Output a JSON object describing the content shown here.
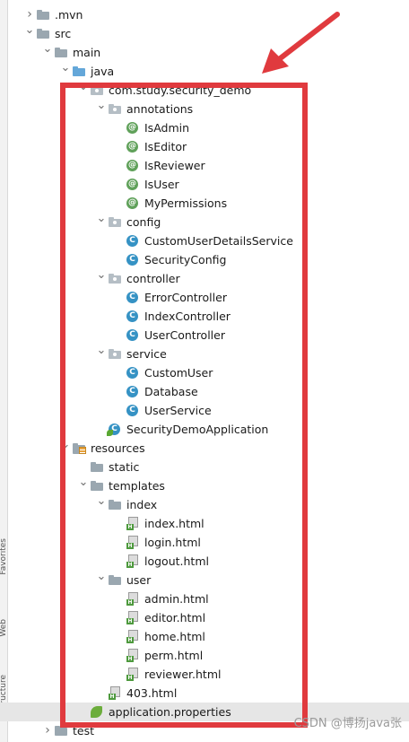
{
  "side_tabs": [
    "Favorites",
    "Web",
    "Structure"
  ],
  "tree": [
    {
      "label": ".mvn",
      "icon": "folder-icon",
      "arrow": "collapsed"
    },
    {
      "label": "src",
      "icon": "folder-icon",
      "arrow": "expanded"
    },
    {
      "label": "main",
      "icon": "folder-icon",
      "arrow": "expanded"
    },
    {
      "label": "java",
      "icon": "source-folder-icon",
      "arrow": "expanded"
    },
    {
      "label": "com.study.security_demo",
      "icon": "package-icon",
      "arrow": "expanded"
    },
    {
      "label": "annotations",
      "icon": "package-icon",
      "arrow": "expanded"
    },
    {
      "label": "IsAdmin",
      "icon": "annotation-icon",
      "arrow": "none"
    },
    {
      "label": "IsEditor",
      "icon": "annotation-icon",
      "arrow": "none"
    },
    {
      "label": "IsReviewer",
      "icon": "annotation-icon",
      "arrow": "none"
    },
    {
      "label": "IsUser",
      "icon": "annotation-icon",
      "arrow": "none"
    },
    {
      "label": "MyPermissions",
      "icon": "annotation-icon",
      "arrow": "none"
    },
    {
      "label": "config",
      "icon": "package-icon",
      "arrow": "expanded"
    },
    {
      "label": "CustomUserDetailsService",
      "icon": "class-icon",
      "arrow": "none"
    },
    {
      "label": "SecurityConfig",
      "icon": "class-icon",
      "arrow": "none"
    },
    {
      "label": "controller",
      "icon": "package-icon",
      "arrow": "expanded"
    },
    {
      "label": "ErrorController",
      "icon": "class-icon",
      "arrow": "none"
    },
    {
      "label": "IndexController",
      "icon": "class-icon",
      "arrow": "none"
    },
    {
      "label": "UserController",
      "icon": "class-icon",
      "arrow": "none"
    },
    {
      "label": "service",
      "icon": "package-icon",
      "arrow": "expanded"
    },
    {
      "label": "CustomUser",
      "icon": "class-icon",
      "arrow": "none"
    },
    {
      "label": "Database",
      "icon": "class-icon",
      "arrow": "none"
    },
    {
      "label": "UserService",
      "icon": "class-icon",
      "arrow": "none"
    },
    {
      "label": "SecurityDemoApplication",
      "icon": "spring-boot-class-icon",
      "arrow": "none"
    },
    {
      "label": "resources",
      "icon": "resources-folder-icon",
      "arrow": "expanded"
    },
    {
      "label": "static",
      "icon": "folder-icon",
      "arrow": "none"
    },
    {
      "label": "templates",
      "icon": "folder-icon",
      "arrow": "expanded"
    },
    {
      "label": "index",
      "icon": "folder-icon",
      "arrow": "expanded"
    },
    {
      "label": "index.html",
      "icon": "html-file-icon",
      "arrow": "none"
    },
    {
      "label": "login.html",
      "icon": "html-file-icon",
      "arrow": "none"
    },
    {
      "label": "logout.html",
      "icon": "html-file-icon",
      "arrow": "none"
    },
    {
      "label": "user",
      "icon": "folder-icon",
      "arrow": "expanded"
    },
    {
      "label": "admin.html",
      "icon": "html-file-icon",
      "arrow": "none"
    },
    {
      "label": "editor.html",
      "icon": "html-file-icon",
      "arrow": "none"
    },
    {
      "label": "home.html",
      "icon": "html-file-icon",
      "arrow": "none"
    },
    {
      "label": "perm.html",
      "icon": "html-file-icon",
      "arrow": "none"
    },
    {
      "label": "reviewer.html",
      "icon": "html-file-icon",
      "arrow": "none"
    },
    {
      "label": "403.html",
      "icon": "html-file-icon",
      "arrow": "none"
    },
    {
      "label": "application.properties",
      "icon": "properties-file-icon",
      "arrow": "none",
      "selected": true
    },
    {
      "label": "test",
      "icon": "folder-icon",
      "arrow": "collapsed"
    }
  ],
  "watermark": "CSDN @博扬java张",
  "colors": {
    "highlight": "#e03a3e",
    "selection": "#e6e6e6"
  }
}
